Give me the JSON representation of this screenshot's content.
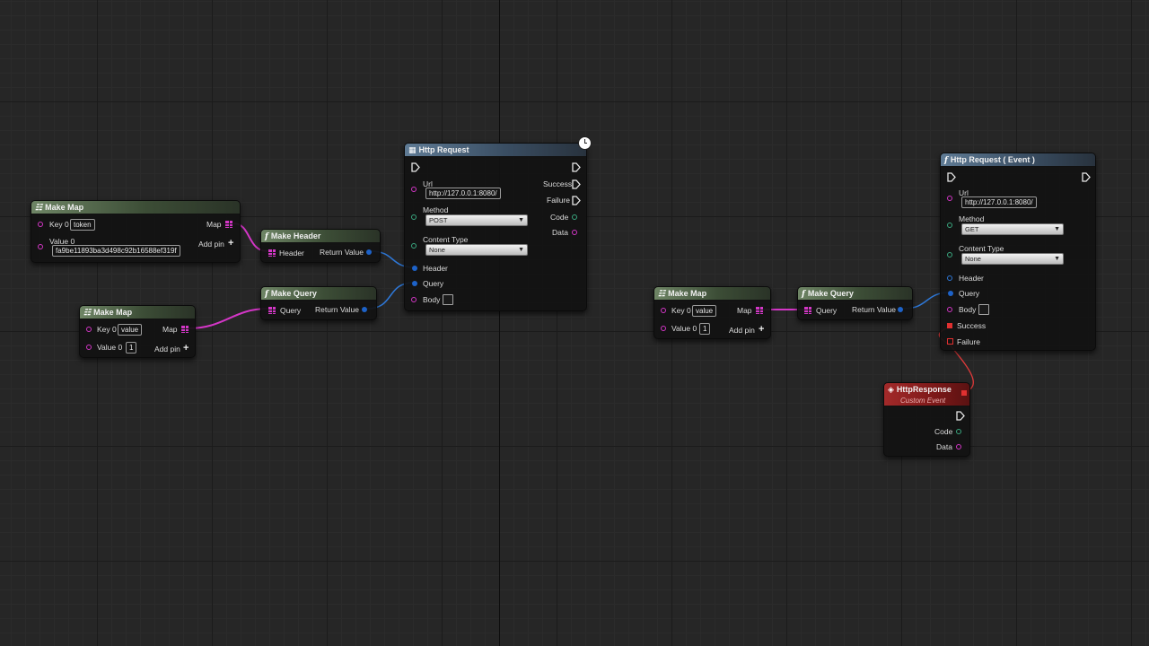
{
  "nodes": {
    "make_map_1": {
      "title": "Make Map",
      "key_label": "Key 0",
      "key_value": "token",
      "value_label": "Value 0",
      "value_value": "fa9be11893ba3d498c92b16588ef319f",
      "map_label": "Map",
      "add_pin": "Add pin"
    },
    "make_header": {
      "title": "Make Header",
      "in_label": "Header",
      "out_label": "Return Value"
    },
    "make_map_2": {
      "title": "Make Map",
      "key_label": "Key 0",
      "key_value": "value",
      "value_label": "Value 0",
      "value_value": "1",
      "map_label": "Map",
      "add_pin": "Add pin"
    },
    "make_query_1": {
      "title": "Make Query",
      "in_label": "Query",
      "out_label": "Return Value"
    },
    "http_request": {
      "title": "Http Request",
      "url_label": "Url",
      "url_value": "http://127.0.0.1:8080/",
      "method_label": "Method",
      "method_value": "POST",
      "content_type_label": "Content Type",
      "content_type_value": "None",
      "header_label": "Header",
      "query_label": "Query",
      "body_label": "Body",
      "success_label": "Success",
      "failure_label": "Failure",
      "code_label": "Code",
      "data_label": "Data"
    },
    "make_map_3": {
      "title": "Make Map",
      "key_label": "Key 0",
      "key_value": "value",
      "value_label": "Value 0",
      "value_value": "1",
      "map_label": "Map",
      "add_pin": "Add pin"
    },
    "make_query_2": {
      "title": "Make Query",
      "in_label": "Query",
      "out_label": "Return Value"
    },
    "http_request_event": {
      "title": "Http Request ( Event )",
      "url_label": "Url",
      "url_value": "http://127.0.0.1:8080/",
      "method_label": "Method",
      "method_value": "GET",
      "content_type_label": "Content Type",
      "content_type_value": "None",
      "header_label": "Header",
      "query_label": "Query",
      "body_label": "Body",
      "success_label": "Success",
      "failure_label": "Failure"
    },
    "http_response": {
      "title": "HttpResponse",
      "subtitle": "Custom Event",
      "code_label": "Code",
      "data_label": "Data"
    }
  },
  "colors": {
    "map_wire": "#d436c7",
    "struct_wire": "#2e78d8",
    "delegate_wire": "#e03a3a",
    "pure_header": "#4f6848",
    "func_header": "#4a6580",
    "event_header": "#8f2020"
  },
  "icons": {
    "function": "f",
    "map": "map-grid-icon",
    "exec": "exec-arrow-icon",
    "latent": "clock-icon",
    "event": "diamond-icon"
  }
}
